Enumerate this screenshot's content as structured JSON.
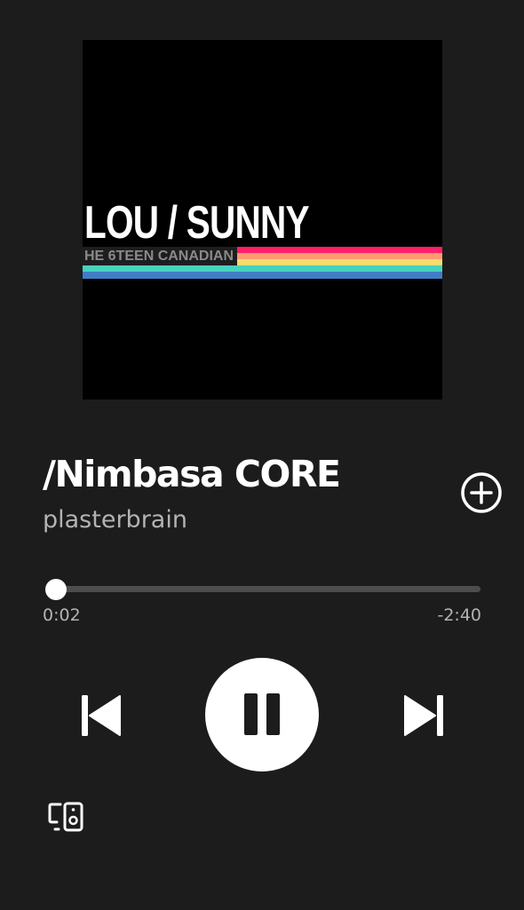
{
  "album_art": {
    "title": "LOU / SUNNY",
    "subtitle": "HE 6TEEN CANADIAN",
    "stripe_colors": [
      "#ff1f6b",
      "#ff9a6e",
      "#f7dc6f",
      "#46d3bd",
      "#3f7ec4"
    ]
  },
  "track": {
    "title": "/Nimbasa CORE",
    "artist": "plasterbrain"
  },
  "playback": {
    "elapsed": "0:02",
    "remaining": "-2:40",
    "progress_fraction": 0.012,
    "state": "playing"
  },
  "icons": {
    "add": "plus-circle-icon",
    "previous": "skip-previous-icon",
    "pause": "pause-icon",
    "next": "skip-next-icon",
    "devices": "connect-devices-icon"
  },
  "colors": {
    "background": "#1c1c1c",
    "primary_text": "#ffffff",
    "secondary_text": "#b3b3b3",
    "progress_track": "#4d4d4d"
  }
}
